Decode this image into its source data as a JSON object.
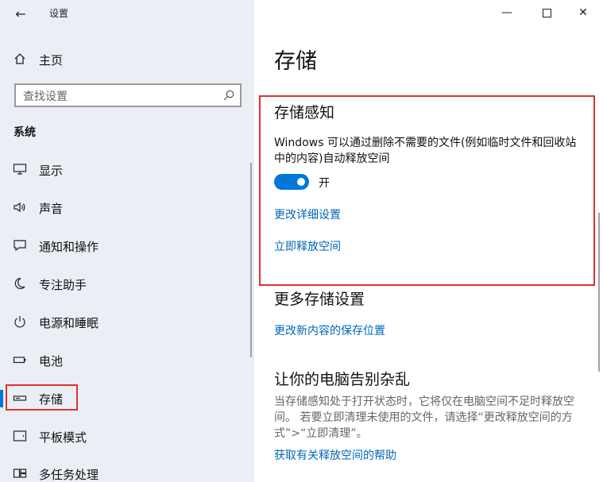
{
  "window": {
    "title": "设置",
    "controls": [
      "minimize",
      "maximize",
      "close"
    ]
  },
  "sidebar": {
    "home_label": "主页",
    "search_placeholder": "查找设置",
    "section_title": "系统",
    "items": [
      {
        "label": "显示",
        "icon": "display-icon"
      },
      {
        "label": "声音",
        "icon": "sound-icon"
      },
      {
        "label": "通知和操作",
        "icon": "notifications-icon"
      },
      {
        "label": "专注助手",
        "icon": "focus-assist-icon"
      },
      {
        "label": "电源和睡眠",
        "icon": "power-icon"
      },
      {
        "label": "电池",
        "icon": "battery-icon"
      },
      {
        "label": "存储",
        "icon": "storage-icon",
        "active": true
      },
      {
        "label": "平板模式",
        "icon": "tablet-icon"
      },
      {
        "label": "多任务处理",
        "icon": "multitasking-icon"
      }
    ]
  },
  "main": {
    "page_title": "存储",
    "storage_sense": {
      "title": "存储感知",
      "description": "Windows 可以通过删除不需要的文件(例如临时文件和回收站中的内容)自动释放空间",
      "toggle_state": "开",
      "link_change": "更改详细设置",
      "link_free": "立即释放空间"
    },
    "more_settings": {
      "title": "更多存储设置",
      "link": "更改新内容的保存位置"
    },
    "declutter": {
      "title": "让你的电脑告别杂乱",
      "description": "当存储感知处于打开状态时，它将仅在电脑空间不足时释放空间。 若要立即清理未使用的文件，请选择“更改释放空间的方式”>“立即清理”。",
      "link": "获取有关释放空间的帮助"
    }
  },
  "colors": {
    "accent": "#0078d7",
    "link": "#0067b8",
    "highlight": "#e03030",
    "sidebar_bg": "#e9eff4"
  }
}
